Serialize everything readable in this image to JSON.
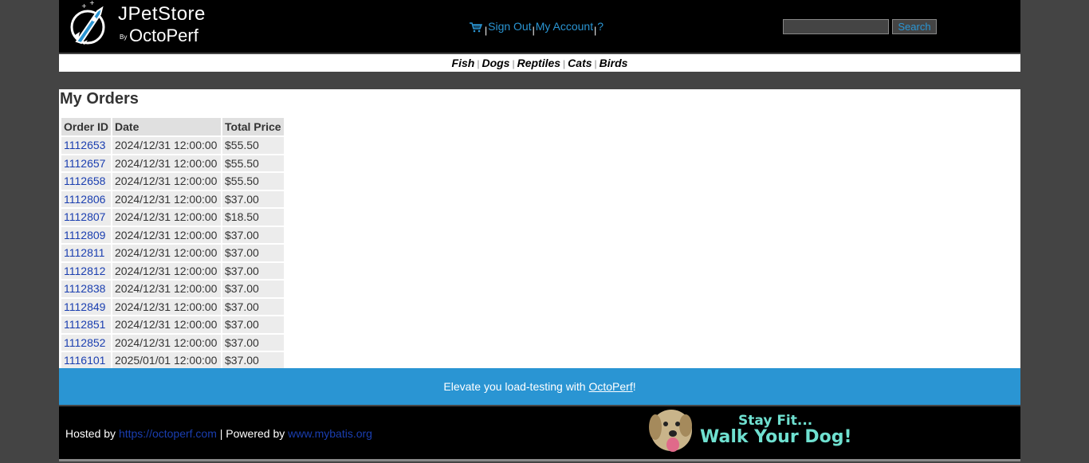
{
  "header": {
    "logo": {
      "brand": "JPetStore",
      "by": "By",
      "company": "OctoPerf"
    },
    "menu": {
      "sign_out": "Sign Out",
      "my_account": "My Account",
      "help": "?",
      "separator": "|"
    },
    "search": {
      "button_label": "Search",
      "value": ""
    }
  },
  "quicklinks": [
    "Fish",
    "Dogs",
    "Reptiles",
    "Cats",
    "Birds"
  ],
  "page": {
    "title": "My Orders",
    "columns": [
      "Order ID",
      "Date",
      "Total Price"
    ],
    "orders": [
      {
        "id": "1112653",
        "date": "2024/12/31 12:00:00",
        "total": "$55.50"
      },
      {
        "id": "1112657",
        "date": "2024/12/31 12:00:00",
        "total": "$55.50"
      },
      {
        "id": "1112658",
        "date": "2024/12/31 12:00:00",
        "total": "$55.50"
      },
      {
        "id": "1112806",
        "date": "2024/12/31 12:00:00",
        "total": "$37.00"
      },
      {
        "id": "1112807",
        "date": "2024/12/31 12:00:00",
        "total": "$18.50"
      },
      {
        "id": "1112809",
        "date": "2024/12/31 12:00:00",
        "total": "$37.00"
      },
      {
        "id": "1112811",
        "date": "2024/12/31 12:00:00",
        "total": "$37.00"
      },
      {
        "id": "1112812",
        "date": "2024/12/31 12:00:00",
        "total": "$37.00"
      },
      {
        "id": "1112838",
        "date": "2024/12/31 12:00:00",
        "total": "$37.00"
      },
      {
        "id": "1112849",
        "date": "2024/12/31 12:00:00",
        "total": "$37.00"
      },
      {
        "id": "1112851",
        "date": "2024/12/31 12:00:00",
        "total": "$37.00"
      },
      {
        "id": "1112852",
        "date": "2024/12/31 12:00:00",
        "total": "$37.00"
      },
      {
        "id": "1116101",
        "date": "2025/01/01 12:00:00",
        "total": "$37.00"
      }
    ]
  },
  "banner": {
    "text_before": "Elevate you load-testing with ",
    "link": "OctoPerf",
    "text_after": "!"
  },
  "footer": {
    "hosted_by": "Hosted by ",
    "hosted_link": "https://octoperf.com",
    "powered_by": " | Powered by ",
    "powered_link": "www.mybatis.org",
    "ad_line1": "Stay Fit...",
    "ad_line2": "Walk Your Dog!"
  },
  "colors": {
    "accent": "#2a95d3",
    "link": "#1a3eb0",
    "header_bg": "#000000",
    "page_bg": "#444444"
  }
}
